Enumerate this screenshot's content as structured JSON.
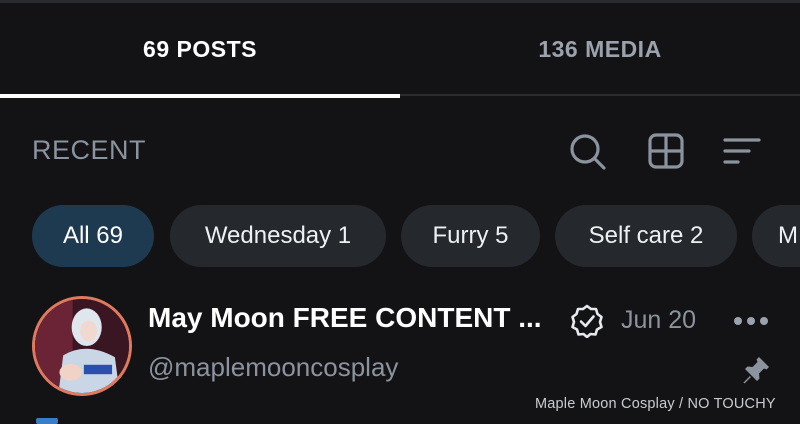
{
  "tabs": [
    {
      "label": "69 POSTS",
      "selected": true
    },
    {
      "label": "136 MEDIA",
      "selected": false
    }
  ],
  "section": {
    "title": "RECENT",
    "icons": [
      "search-icon",
      "grid-view-icon",
      "sort-icon"
    ]
  },
  "chips": [
    {
      "label": "All 69",
      "active": true
    },
    {
      "label": "Wednesday 1",
      "active": false
    },
    {
      "label": "Furry 5",
      "active": false
    },
    {
      "label": "Self care 2",
      "active": false
    },
    {
      "label": "M",
      "active": false
    }
  ],
  "post": {
    "name": "May Moon FREE CONTENT ...",
    "handle": "@maplemooncosplay",
    "date": "Jun 20",
    "verified": true,
    "pinned": true,
    "watermark": "Maple Moon Cosplay / NO TOUCHY"
  },
  "colors": {
    "background": "#131316",
    "active_chip": "#1e3a50",
    "chip": "#25282d",
    "muted_text": "#8a939e",
    "avatar_ring": "#e07a5f"
  }
}
